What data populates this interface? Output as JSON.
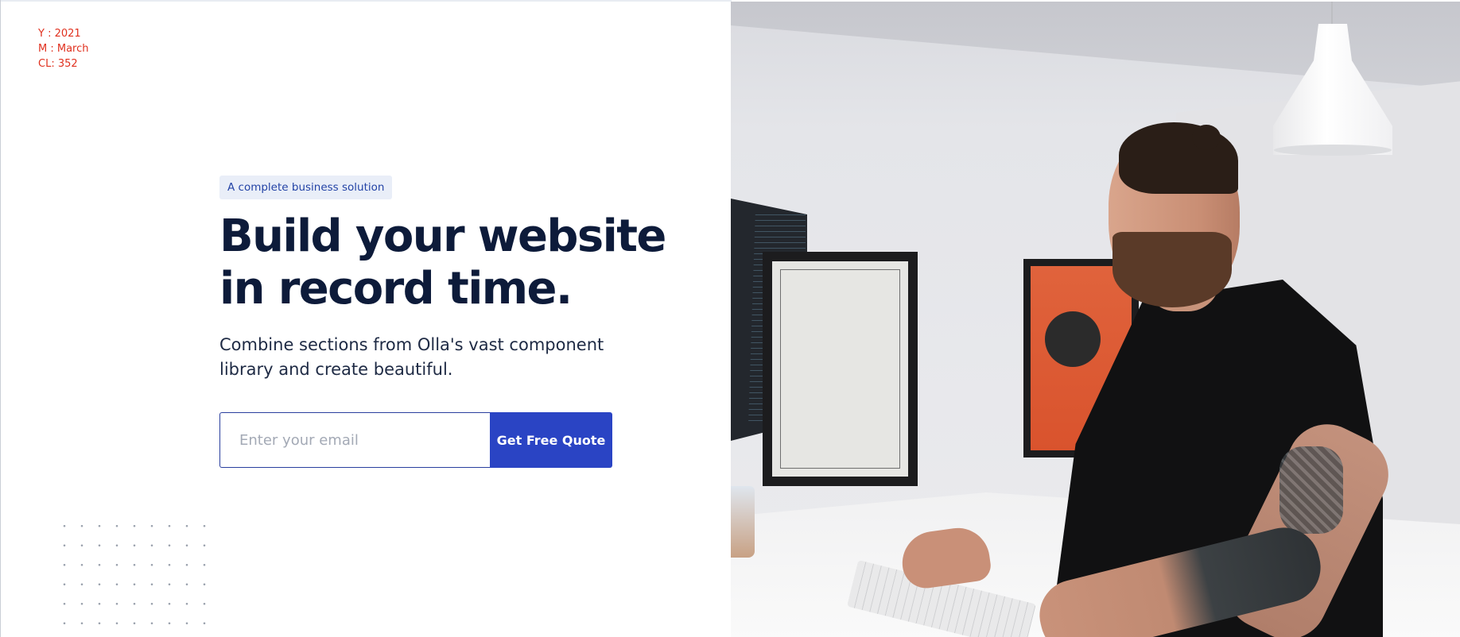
{
  "meta": {
    "year": "Y : 2021",
    "month": "M : March",
    "cl": "CL: 352"
  },
  "hero": {
    "badge": "A complete business solution",
    "title": "Build your website in record time.",
    "subtitle": "Combine sections from Olla's vast component library and create beautiful.",
    "email_placeholder": "Enter your email",
    "email_value": "",
    "cta_label": "Get Free Quote"
  },
  "photo": {
    "description_icon": "photo-man-at-desk"
  },
  "colors": {
    "accent": "#2a44c4",
    "badge_bg": "#e9eef8",
    "title": "#0d1b3a",
    "meta": "#e0301e"
  }
}
